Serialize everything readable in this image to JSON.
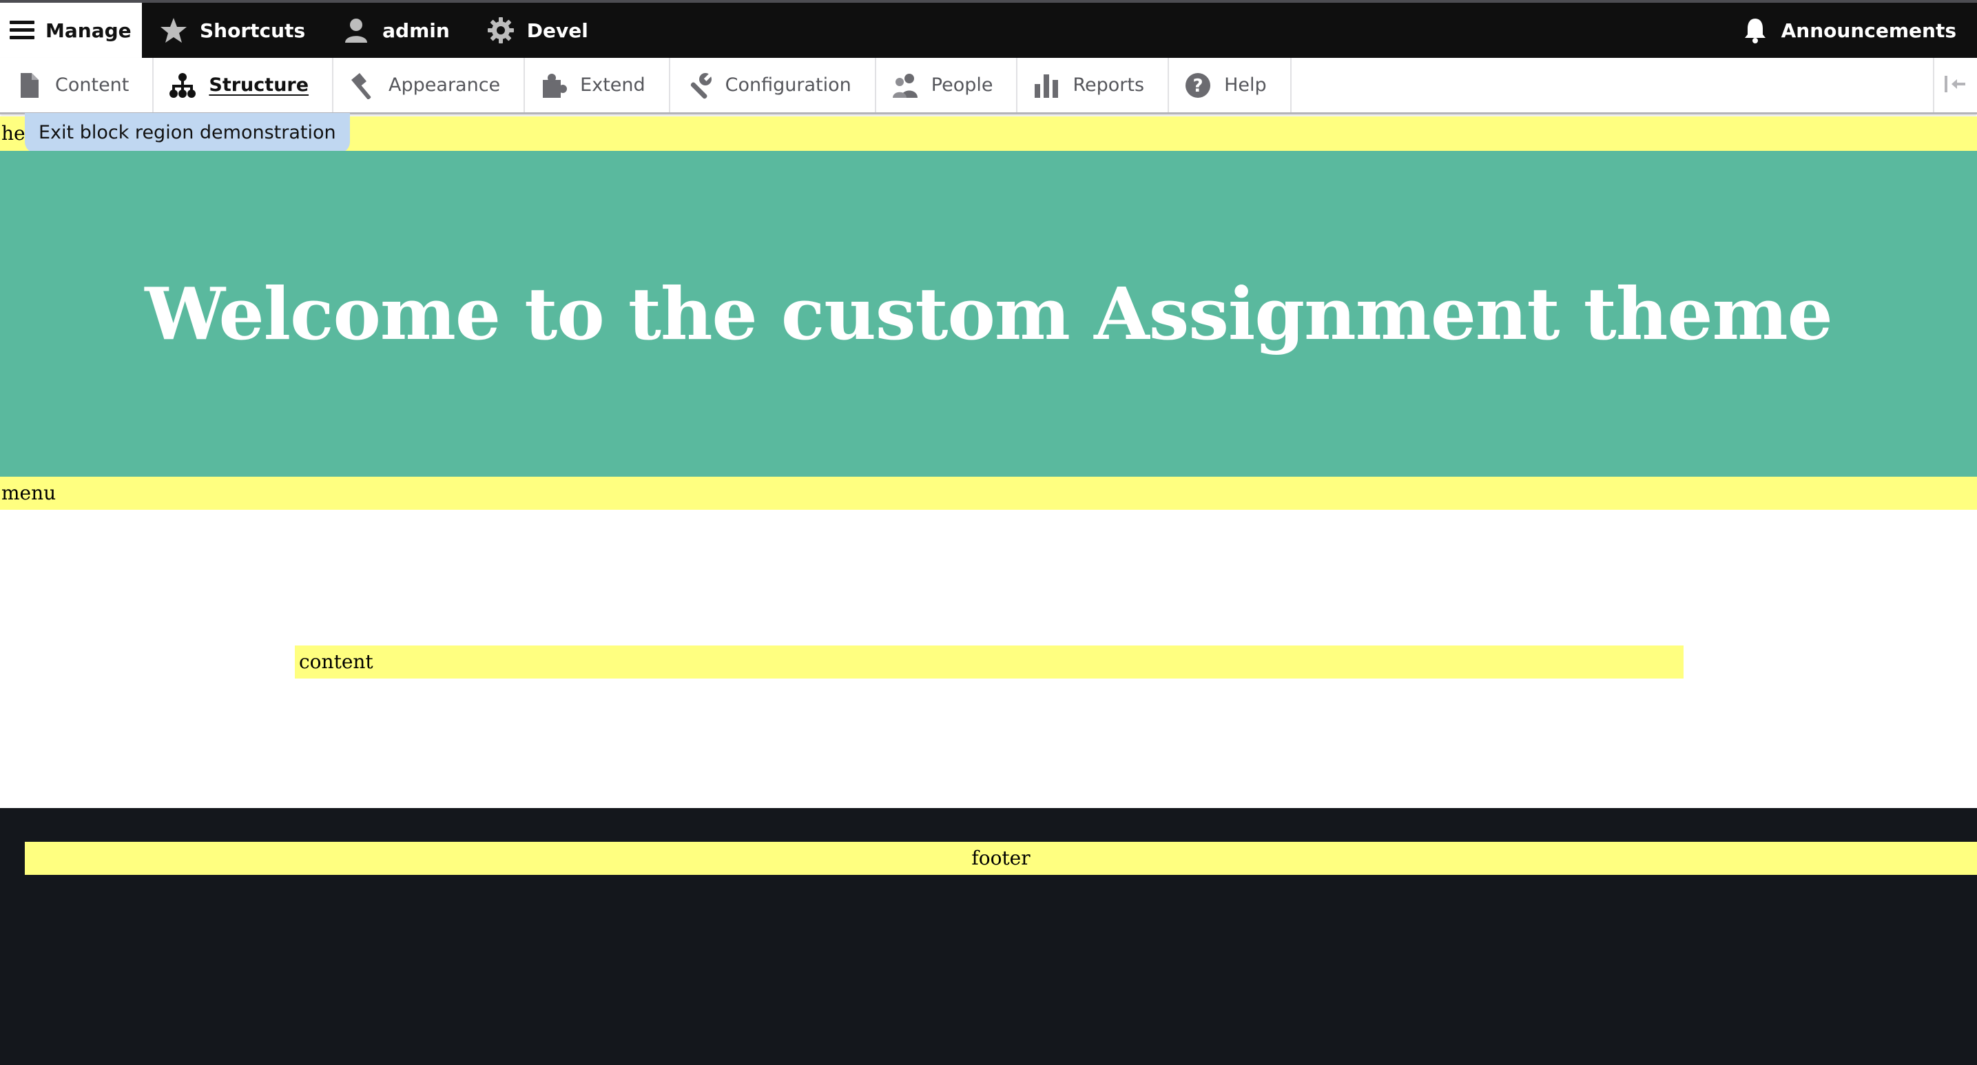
{
  "toolbar": {
    "items": [
      {
        "label": "Manage",
        "icon": "hamburger-icon"
      },
      {
        "label": "Shortcuts",
        "icon": "star-icon"
      },
      {
        "label": "admin",
        "icon": "user-icon"
      },
      {
        "label": "Devel",
        "icon": "gear-icon"
      }
    ],
    "announcements": {
      "label": "Announcements",
      "icon": "bell-icon"
    }
  },
  "tray": {
    "items": [
      {
        "label": "Content",
        "icon": "file-icon"
      },
      {
        "label": "Structure",
        "icon": "sitemap-icon"
      },
      {
        "label": "Appearance",
        "icon": "paintbrush-icon"
      },
      {
        "label": "Extend",
        "icon": "puzzle-icon"
      },
      {
        "label": "Configuration",
        "icon": "wrench-icon"
      },
      {
        "label": "People",
        "icon": "people-icon"
      },
      {
        "label": "Reports",
        "icon": "bar-chart-icon"
      },
      {
        "label": "Help",
        "icon": "help-icon"
      }
    ],
    "active": "Structure"
  },
  "regions": {
    "header": "header",
    "exit_demo": "Exit block region demonstration",
    "menu": "menu",
    "content": "content",
    "footer": "footer"
  },
  "banner": {
    "title": "Welcome to the custom Assignment theme"
  },
  "colors": {
    "region_highlight": "#ffff80",
    "banner_bg": "#5ab99e",
    "toolbar_bg": "#0f0f0f",
    "footer_bg": "#14171c",
    "exit_button_bg": "#c0d7f1"
  }
}
